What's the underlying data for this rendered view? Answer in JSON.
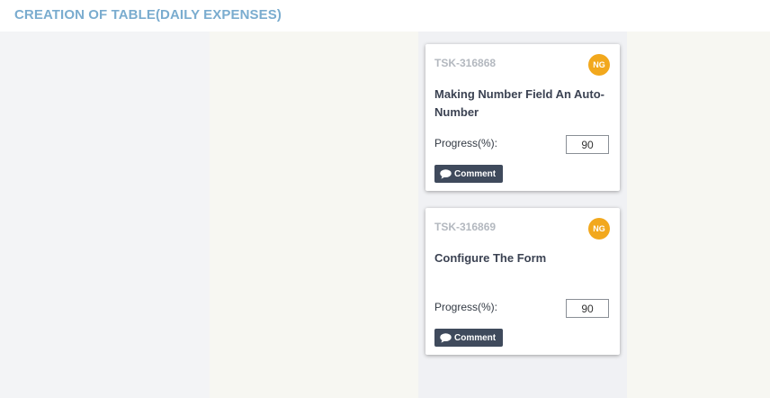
{
  "header": {
    "title": "CREATION OF TABLE(DAILY EXPENSES)"
  },
  "colors": {
    "header_title": "#7aaccf",
    "avatar": "#f2a81d",
    "comment_button": "#3f4a5c"
  },
  "cards": [
    {
      "id": "TSK-316868",
      "assignee_initials": "NG",
      "title": "Making Number Field An Auto-Number",
      "progress_label": "Progress(%):",
      "progress_value": "90",
      "comment_label": "Comment",
      "comment_icon": "speech-bubble-icon"
    },
    {
      "id": "TSK-316869",
      "assignee_initials": "NG",
      "title": "Configure The Form",
      "progress_label": "Progress(%):",
      "progress_value": "90",
      "comment_label": "Comment",
      "comment_icon": "speech-bubble-icon"
    }
  ]
}
